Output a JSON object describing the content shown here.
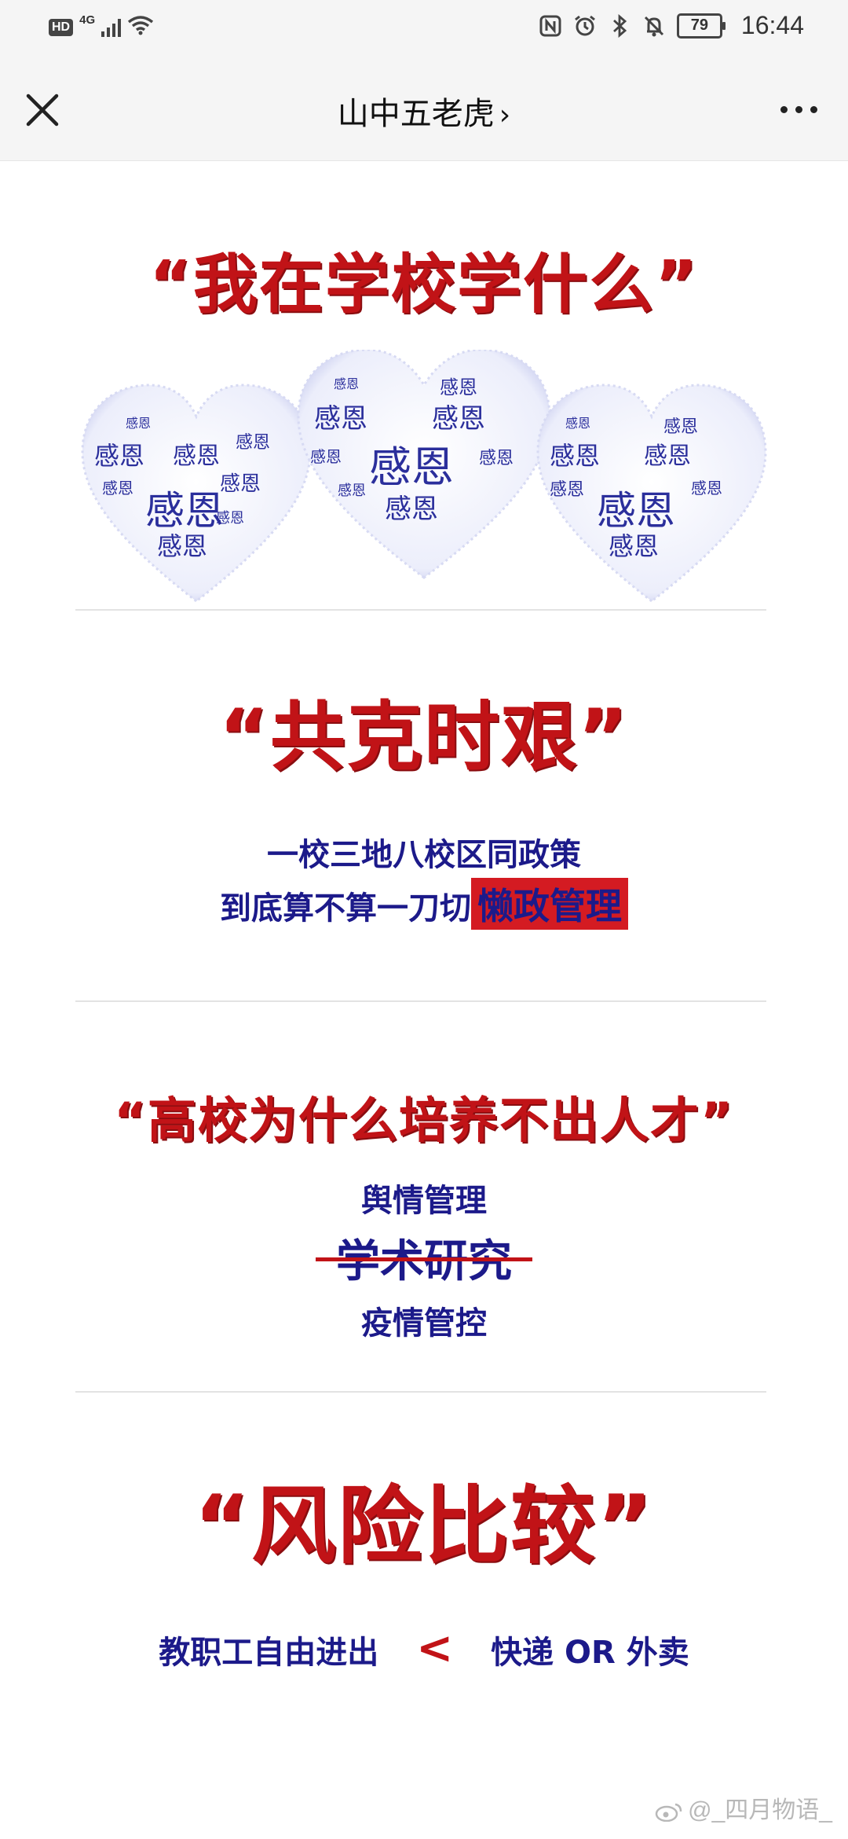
{
  "status_bar": {
    "hd_badge": "HD",
    "network": "4G",
    "battery": "79",
    "time": "16:44",
    "icons": [
      "nfc-icon",
      "alarm-icon",
      "bluetooth-icon",
      "mute-icon"
    ]
  },
  "nav": {
    "title": "山中五老虎",
    "chevron": "›"
  },
  "article": {
    "section1": {
      "heading": "“我在学校学什么”",
      "cloud_word": "感恩"
    },
    "section2": {
      "heading": "“共克时艰”",
      "line1": "一校三地八校区同政策",
      "line2_prefix": "到底算不算一刀切",
      "line2_highlight": "懒政管理"
    },
    "section3": {
      "heading": "“高校为什么培养不出人才”",
      "line1": "舆情管理",
      "line2_struck": "学术研究",
      "line3": "疫情管控"
    },
    "section4": {
      "heading": "“风险比较”",
      "left_text": "教职工自由进出",
      "operator": "<",
      "right_text": "快递 OR 外卖"
    }
  },
  "watermark": "@_四月物语_",
  "colors": {
    "heading_red": "#c11317",
    "text_navy": "#1c1a8a",
    "cloud_blue": "#2b2f9c"
  }
}
